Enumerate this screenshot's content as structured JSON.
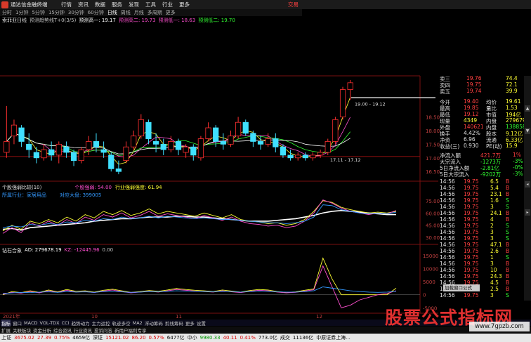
{
  "app": {
    "title": "通达信金融终端",
    "trade_label": "交易"
  },
  "menu": [
    "行情",
    "资讯",
    "数据",
    "服务",
    "发现",
    "工具",
    "行业",
    "更多"
  ],
  "periods": [
    "分时",
    "1分钟",
    "5分钟",
    "15分钟",
    "30分钟",
    "60分钟",
    "日线",
    "周线",
    "月线",
    "多周期",
    "更多"
  ],
  "active_period": "日线",
  "main_caption": {
    "name": "索菲亚日线",
    "indicator": "预测趋势线T+0(3/5)",
    "items": [
      {
        "label": "预测高一: 19.17",
        "color": "#ffffff"
      },
      {
        "label": "预测高二: 19.73",
        "color": "#ff4fd0"
      },
      {
        "label": "预测低一: 18.63",
        "color": "#ff4fd0"
      },
      {
        "label": "预测低二: 19.70",
        "color": "#33ff33"
      }
    ]
  },
  "price_axis": [
    "18.50",
    "18.00",
    "17.50",
    "17.00",
    "16.50"
  ],
  "price_marks": {
    "high": "19.00 - 19.12",
    "low": "17.11 - 17.12"
  },
  "ind1_caption": {
    "name": "个股强弱比较(10)",
    "sub": "所属行业：家居用品",
    "v1": "个股强弱: 54.00",
    "v2": "行业强弱强度: 61.94",
    "v3": "对应大盘: 399005"
  },
  "ind1_axis": [
    "75.00",
    "60.00",
    "45.00",
    "30.00"
  ],
  "ind2_caption": {
    "name": "钻石合象",
    "ad": "AD: 279678.19",
    "kz": "KZ: -12445.96",
    "zero": "0.00"
  },
  "ind2_axis": [
    "15000",
    "10000",
    "5000",
    "0",
    "-5000"
  ],
  "date_labels": [
    "2021年",
    "10",
    "11",
    "12"
  ],
  "quotes": {
    "asks": [
      {
        "k": "卖三",
        "p": "19.76",
        "v": "74.4"
      },
      {
        "k": "卖四",
        "p": "19.75",
        "v": "72.1"
      },
      {
        "k": "卖五",
        "p": "19.74",
        "v": "39.9"
      }
    ],
    "stats": [
      {
        "k1": "今开",
        "v1": "19.40",
        "k2": "均价",
        "v2": "19.61"
      },
      {
        "k1": "最高",
        "v1": "19.85",
        "k2": "量比",
        "v2": "1.53"
      },
      {
        "k1": "最低",
        "v1": "19.12",
        "k2": "市值",
        "v2": "194亿"
      },
      {
        "k1": "现量",
        "v1": "4349",
        "k2": "内盘",
        "v2": "279679"
      },
      {
        "k1": "外盘",
        "v1": "140621",
        "k2": "内盘",
        "v2": "138858"
      },
      {
        "k1": "换手",
        "v1": "4.42%",
        "k2": "股本",
        "v2": "9.12亿"
      },
      {
        "k1": "净资",
        "v1": "6.96",
        "k2": "流通",
        "v2": "6.33亿"
      },
      {
        "k1": "收益(三)",
        "v1": "0.930",
        "k2": "PE(动)",
        "v2": "15.9"
      }
    ],
    "flows": [
      {
        "k": "净流入额",
        "v": "421.7万",
        "p": "1%"
      },
      {
        "k": "大宗流入",
        "v": "-1273万",
        "p": "-3%"
      },
      {
        "k": "5日净流入额",
        "v": "-2.81亿",
        "p": "-0%"
      },
      {
        "k": "5日大宗流入",
        "v": "-9202万",
        "p": "-3%"
      }
    ],
    "ticks": [
      {
        "t": "14:56",
        "p": "19.75",
        "v": "6.5",
        "s": "B"
      },
      {
        "t": "14:56",
        "p": "19.75",
        "v": "5.4",
        "s": "B"
      },
      {
        "t": "14:56",
        "p": "19.75",
        "v": "23.1",
        "s": "B"
      },
      {
        "t": "14:56",
        "p": "19.75",
        "v": "1.6",
        "s": "S"
      },
      {
        "t": "14:56",
        "p": "19.75",
        "v": "3",
        "s": "S"
      },
      {
        "t": "14:56",
        "p": "19.75",
        "v": "24.1",
        "s": "B"
      },
      {
        "t": "14:56",
        "p": "19.75",
        "v": "4",
        "s": "B"
      },
      {
        "t": "14:56",
        "p": "19.75",
        "v": "2",
        "s": "S"
      },
      {
        "t": "14:56",
        "p": "19.75",
        "v": "3",
        "s": "S"
      },
      {
        "t": "14:56",
        "p": "19.75",
        "v": "3",
        "s": "S"
      },
      {
        "t": "14:56",
        "p": "19.75",
        "v": "47.1",
        "s": "B"
      },
      {
        "t": "14:56",
        "p": "19.75",
        "v": "2.6",
        "s": "B"
      },
      {
        "t": "14:56",
        "p": "19.75",
        "v": "1",
        "s": "S"
      },
      {
        "t": "14:56",
        "p": "19.75",
        "v": "3",
        "s": "B"
      },
      {
        "t": "14:56",
        "p": "19.75",
        "v": "10",
        "s": "B"
      },
      {
        "t": "14:56",
        "p": "19.75",
        "v": "24.3",
        "s": "B"
      },
      {
        "t": "14:56",
        "p": "19.75",
        "v": "4.5",
        "s": "B"
      },
      {
        "t": "14:56",
        "p": "19.75",
        "v": "2.5",
        "s": "B"
      },
      {
        "t": "14:56",
        "p": "19.75",
        "v": "3",
        "s": "S"
      }
    ]
  },
  "tabs1": [
    "指标",
    "窗口",
    "MACD",
    "VOL-TDX",
    "CCI",
    "趋势动力",
    "主力运控",
    "轨迹多空",
    "MA2",
    "浮动筹码",
    "剪线筹码",
    "更多",
    "设置"
  ],
  "tabs2": [
    "扩展",
    "关联板块",
    "资金分析",
    "综合资讯",
    "行业资讯",
    "投诉问答",
    "新用户福利专享"
  ],
  "status": [
    {
      "text": "上证",
      "c": ""
    },
    {
      "text": "3675.02",
      "c": "r"
    },
    {
      "text": "27.39",
      "c": "r"
    },
    {
      "text": "0.75%",
      "c": "r"
    },
    {
      "text": "4659亿",
      "c": ""
    },
    {
      "text": "深证",
      "c": ""
    },
    {
      "text": "15121.02",
      "c": "r"
    },
    {
      "text": "86.20",
      "c": "r"
    },
    {
      "text": "0.57%",
      "c": "r"
    },
    {
      "text": "6477亿",
      "c": ""
    },
    {
      "text": "中小",
      "c": ""
    },
    {
      "text": "9980.33",
      "c": "g"
    },
    {
      "text": "40.11",
      "c": "r"
    },
    {
      "text": "0.41%",
      "c": "r"
    },
    {
      "text": "773.0亿",
      "c": ""
    },
    {
      "text": "成交",
      "c": ""
    },
    {
      "text": "11136亿",
      "c": ""
    },
    {
      "text": "中原证券上海...",
      "c": ""
    }
  ],
  "watermark": {
    "text": "股票公式指标网",
    "url": "www.7gpzb.com",
    "tooltip": "加载窗口公式"
  },
  "chart_data": {
    "type": "line",
    "note_ticks": [],
    "candles": [
      {
        "o": 17.2,
        "c": 17.6,
        "h": 18.9,
        "l": 17.0
      },
      {
        "o": 17.8,
        "c": 18.2,
        "h": 18.4,
        "l": 17.5
      },
      {
        "o": 18.1,
        "c": 17.6,
        "h": 18.2,
        "l": 17.4
      },
      {
        "o": 17.5,
        "c": 17.3,
        "h": 17.9,
        "l": 17.0
      },
      {
        "o": 17.2,
        "c": 17.0,
        "h": 17.4,
        "l": 16.8
      },
      {
        "o": 17.0,
        "c": 17.3,
        "h": 17.5,
        "l": 16.9
      },
      {
        "o": 17.3,
        "c": 17.1,
        "h": 17.6,
        "l": 16.9
      },
      {
        "o": 17.1,
        "c": 17.5,
        "h": 17.6,
        "l": 16.8
      },
      {
        "o": 17.4,
        "c": 17.2,
        "h": 17.6,
        "l": 17.0
      },
      {
        "o": 17.2,
        "c": 16.9,
        "h": 17.3,
        "l": 16.7
      },
      {
        "o": 16.9,
        "c": 17.3,
        "h": 17.4,
        "l": 16.8
      },
      {
        "o": 17.3,
        "c": 17.6,
        "h": 17.8,
        "l": 17.1
      },
      {
        "o": 17.6,
        "c": 17.4,
        "h": 17.9,
        "l": 17.2
      },
      {
        "o": 17.3,
        "c": 17.2,
        "h": 17.6,
        "l": 17.0
      },
      {
        "o": 17.1,
        "c": 16.6,
        "h": 17.2,
        "l": 16.5
      },
      {
        "o": 16.6,
        "c": 16.5,
        "h": 16.9,
        "l": 16.4
      },
      {
        "o": 16.9,
        "c": 17.4,
        "h": 17.6,
        "l": 16.8
      },
      {
        "o": 17.4,
        "c": 17.8,
        "h": 18.0,
        "l": 17.3
      },
      {
        "o": 17.8,
        "c": 18.4,
        "h": 18.6,
        "l": 17.7
      },
      {
        "o": 18.3,
        "c": 17.7,
        "h": 18.4,
        "l": 17.5
      },
      {
        "o": 17.6,
        "c": 17.5,
        "h": 17.9,
        "l": 17.2
      },
      {
        "o": 17.5,
        "c": 17.3,
        "h": 17.7,
        "l": 17.1
      },
      {
        "o": 17.3,
        "c": 17.6,
        "h": 17.8,
        "l": 17.2
      },
      {
        "o": 17.6,
        "c": 17.3,
        "h": 17.7,
        "l": 17.1
      },
      {
        "o": 17.2,
        "c": 17.4,
        "h": 17.5,
        "l": 17.0
      },
      {
        "o": 17.4,
        "c": 17.1,
        "h": 17.5,
        "l": 16.9
      },
      {
        "o": 17.0,
        "c": 17.7,
        "h": 17.8,
        "l": 16.9
      },
      {
        "o": 17.7,
        "c": 18.1,
        "h": 18.3,
        "l": 17.6
      },
      {
        "o": 18.1,
        "c": 17.6,
        "h": 18.2,
        "l": 17.4
      },
      {
        "o": 17.6,
        "c": 17.5,
        "h": 17.9,
        "l": 17.3
      },
      {
        "o": 17.5,
        "c": 17.8,
        "h": 18.0,
        "l": 17.4
      },
      {
        "o": 17.8,
        "c": 18.3,
        "h": 18.5,
        "l": 17.7
      },
      {
        "o": 18.3,
        "c": 17.9,
        "h": 18.4,
        "l": 17.8
      },
      {
        "o": 17.9,
        "c": 17.6,
        "h": 18.0,
        "l": 17.4
      },
      {
        "o": 17.6,
        "c": 17.5,
        "h": 17.8,
        "l": 17.3
      },
      {
        "o": 17.5,
        "c": 17.7,
        "h": 17.9,
        "l": 17.4
      },
      {
        "o": 17.7,
        "c": 17.4,
        "h": 17.9,
        "l": 17.2
      },
      {
        "o": 17.4,
        "c": 17.1,
        "h": 17.5,
        "l": 17.0
      },
      {
        "o": 17.1,
        "c": 17.0,
        "h": 17.3,
        "l": 16.9
      },
      {
        "o": 17.0,
        "c": 17.1,
        "h": 17.2,
        "l": 16.9
      },
      {
        "o": 17.1,
        "c": 17.0,
        "h": 17.2,
        "l": 16.9
      },
      {
        "o": 17.0,
        "c": 17.1,
        "h": 17.2,
        "l": 16.9
      },
      {
        "o": 17.1,
        "c": 17.2,
        "h": 17.3,
        "l": 17.0
      },
      {
        "o": 17.2,
        "c": 17.6,
        "h": 17.7,
        "l": 17.1
      },
      {
        "o": 17.6,
        "c": 18.4,
        "h": 18.5,
        "l": 17.5
      },
      {
        "o": 18.5,
        "c": 19.5,
        "h": 19.6,
        "l": 18.4
      },
      {
        "o": 19.5,
        "c": 19.75,
        "h": 19.85,
        "l": 19.12
      }
    ],
    "ind1_lines": [
      {
        "color": "#ffffff",
        "values": [
          40,
          41,
          39,
          42,
          43,
          44,
          45,
          46,
          47,
          48,
          50,
          51,
          52,
          53,
          53,
          54,
          55,
          55,
          55,
          56,
          56,
          55,
          55,
          54,
          53,
          52,
          51,
          50,
          50,
          50,
          51,
          52,
          53,
          55,
          57,
          60,
          62,
          63,
          62,
          61,
          60,
          59,
          58,
          58
        ]
      },
      {
        "color": "#ffff33",
        "values": [
          38,
          45,
          40,
          50,
          47,
          52,
          48,
          55,
          50,
          58,
          54,
          62,
          58,
          63,
          57,
          60,
          65,
          59,
          62,
          60,
          58,
          56,
          60,
          57,
          54,
          58,
          52,
          50,
          49,
          47,
          48,
          45,
          47,
          52,
          62,
          75,
          73,
          67,
          64,
          62,
          60,
          61,
          60,
          62
        ]
      },
      {
        "color": "#ff4fd0",
        "values": [
          35,
          42,
          36,
          48,
          44,
          50,
          45,
          52,
          47,
          55,
          51,
          58,
          55,
          60,
          54,
          57,
          62,
          56,
          59,
          57,
          55,
          53,
          57,
          54,
          51,
          55,
          50,
          47,
          46,
          44,
          45,
          42,
          44,
          50,
          60,
          76,
          72,
          66,
          62,
          60,
          58,
          60,
          59,
          63
        ]
      },
      {
        "color": "#3399ff",
        "values": [
          42,
          44,
          43,
          46,
          45,
          47,
          46,
          49,
          48,
          51,
          50,
          53,
          52,
          55,
          53,
          54,
          56,
          54,
          56,
          55,
          54,
          53,
          54,
          53,
          52,
          52,
          51,
          50,
          49,
          48,
          48,
          47,
          48,
          50,
          55,
          70,
          69,
          64,
          62,
          60,
          59,
          60,
          59,
          61
        ]
      }
    ],
    "ind2_lines": [
      {
        "color": "#ffff33",
        "values": [
          0,
          1200,
          800,
          1500,
          900,
          1800,
          1100,
          2000,
          1300,
          1500,
          1000,
          1700,
          2100,
          1500,
          900,
          1200,
          1600,
          1300,
          1800,
          2400,
          2000,
          1700,
          1500,
          1200,
          1800,
          1400,
          1000,
          1600,
          2000,
          1800,
          1200,
          900,
          1100,
          1700,
          2200,
          14000,
          6000,
          0,
          0,
          0,
          0,
          0,
          0,
          2500
        ]
      },
      {
        "color": "#ff4fd0",
        "values": [
          200,
          900,
          600,
          1200,
          700,
          1500,
          900,
          1700,
          1000,
          1200,
          800,
          1400,
          1800,
          1200,
          700,
          1000,
          1300,
          1000,
          1500,
          2000,
          1700,
          1400,
          1200,
          1000,
          1500,
          1100,
          800,
          1300,
          1700,
          1500,
          1000,
          700,
          900,
          1400,
          1900,
          11000,
          3000,
          -5000,
          -4000,
          -2000,
          -1000,
          0,
          500,
          1500
        ]
      },
      {
        "color": "#3399ff",
        "values": [
          500,
          700,
          900,
          800,
          1000,
          1100,
          900,
          1200,
          1000,
          1100,
          900,
          1200,
          1300,
          1100,
          900,
          1000,
          1200,
          1100,
          1300,
          1500,
          1400,
          1300,
          1200,
          1100,
          1300,
          1200,
          1000,
          1200,
          1400,
          1300,
          1100,
          1000,
          1000,
          1200,
          1500,
          3000,
          2500,
          2000,
          1500,
          1200,
          1000,
          900,
          1000,
          1300
        ]
      }
    ]
  }
}
